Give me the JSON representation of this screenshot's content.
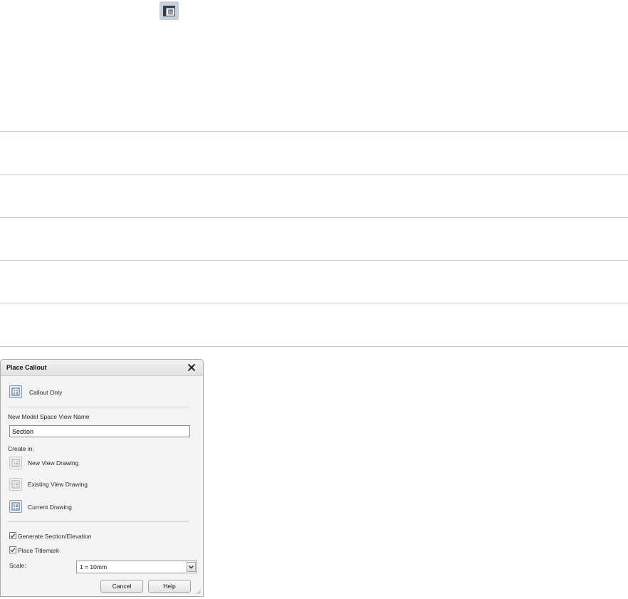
{
  "toolbar": {
    "icon": "properties-palette-icon"
  },
  "dialog": {
    "title": "Place Callout",
    "close_icon": "close-icon",
    "callout_only_label": "Callout Only",
    "view_name_label": "New Model Space View Name",
    "view_name_value": "Section",
    "create_in_label": "Create in:",
    "options": [
      {
        "label": "New View Drawing",
        "icon": "new-view-drawing-icon",
        "active": false
      },
      {
        "label": "Existing View Drawing",
        "icon": "existing-view-drawing-icon",
        "active": false
      },
      {
        "label": "Current Drawing",
        "icon": "current-drawing-icon",
        "active": true
      }
    ],
    "generate_section_label": "Generate Section/Elevation",
    "generate_section_checked": true,
    "place_titlemark_label": "Place Titlemark",
    "place_titlemark_checked": true,
    "scale_label": "Scale:",
    "scale_value": "1 = 10mm",
    "cancel_label": "Cancel",
    "help_label": "Help"
  },
  "colors": {
    "active_icon_border": "#7f9bbf",
    "check_green": "#2e7d1e",
    "divider": "#c9c9c9"
  }
}
